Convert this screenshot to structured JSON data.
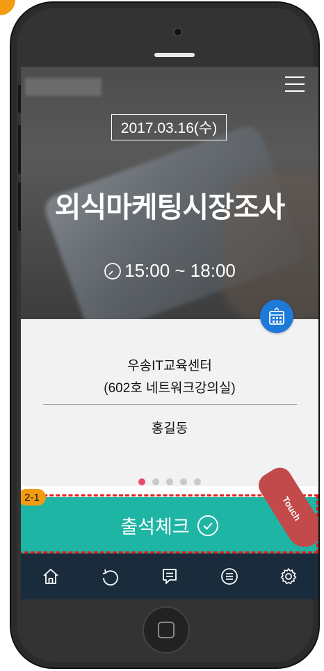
{
  "header": {
    "date": "2017.03.16(수)",
    "title": "외식마케팅시장조사",
    "time": "15:00 ~ 18:00"
  },
  "event": {
    "location_line1": "우송IT교육센터",
    "location_line2": "(602호 네트워크강의실)",
    "instructor": "홍길동"
  },
  "pagination": {
    "count": 5,
    "active_index": 0
  },
  "checkin": {
    "label": "출석체크"
  },
  "annotation": {
    "step": "2-1",
    "touch_label": "Touch"
  },
  "tabbar": {
    "icons": [
      "home-icon",
      "refresh-icon",
      "message-icon",
      "list-icon",
      "settings-icon"
    ]
  },
  "colors": {
    "accent_teal": "#1fb5a4",
    "tabbar_bg": "#1a2b3c",
    "calendar_blue": "#1e7ad8",
    "dot_active": "#e94b6a",
    "annotation_orange": "#f39c12",
    "dashed_red": "#e21d1d"
  }
}
